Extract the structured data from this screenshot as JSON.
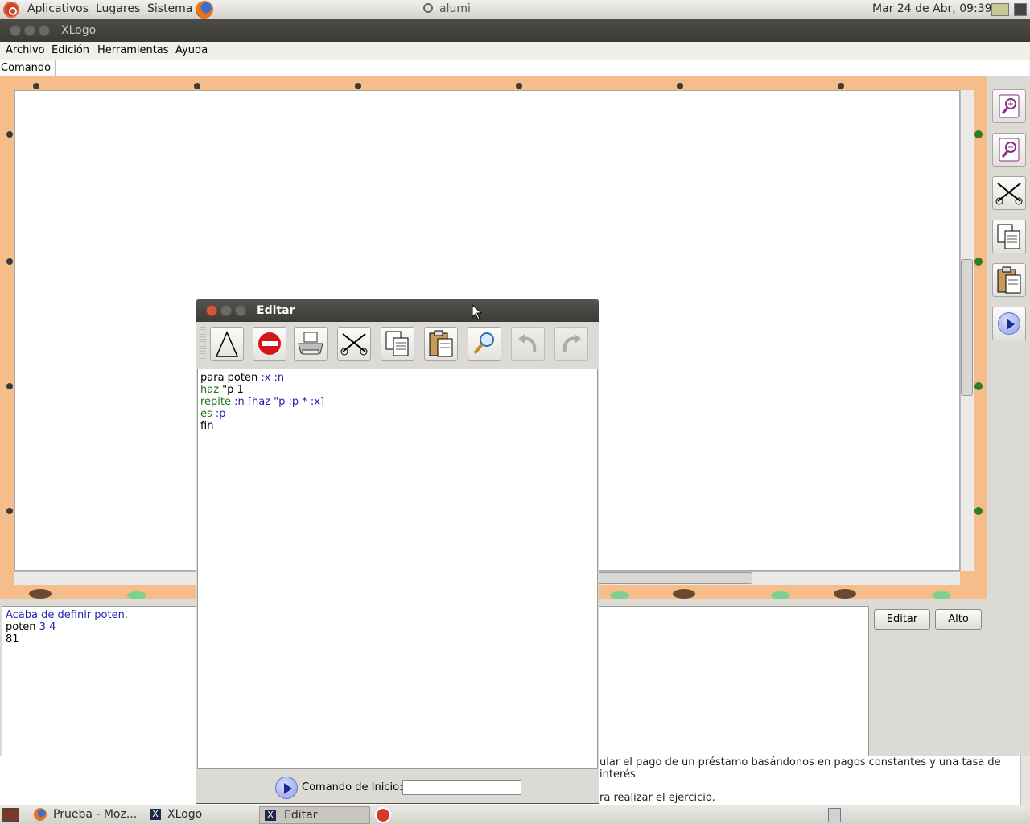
{
  "top_panel": {
    "menus": [
      "Aplicativos",
      "Lugares",
      "Sistema"
    ],
    "window_title": "alumi",
    "clock": "Mar 24 de Abr, 09:39"
  },
  "xlogo": {
    "title": "XLogo",
    "menus": [
      "Archivo",
      "Edición",
      "Herramientas",
      "Ayuda"
    ],
    "command_label": "Comando",
    "history": [
      {
        "text": "Acaba de definir poten.",
        "color": "#2323b8"
      },
      {
        "parts": [
          "poten",
          "3 4"
        ]
      },
      {
        "text": "81"
      }
    ],
    "buttons": {
      "edit": "Editar",
      "stop": "Alto"
    },
    "right_toolbar": [
      "zoom-in-icon",
      "zoom-out-icon",
      "scissors-icon",
      "copy-icon",
      "paste-icon",
      "play-icon"
    ]
  },
  "editor": {
    "title": "Editar",
    "toolbar": [
      "triangle-icon",
      "stop-icon",
      "printer-icon",
      "scissors-icon",
      "copy-icon",
      "paste-icon",
      "search-icon",
      "undo-icon",
      "redo-icon"
    ],
    "code": [
      {
        "a": "para poten ",
        "b": ":x :n",
        "c": ""
      },
      {
        "a": "haz ",
        "b": "\"p 1",
        "c": ""
      },
      {
        "a": "repite ",
        "b": ":n ",
        "c": "[haz \"p :p * :x]"
      },
      {
        "a": "es ",
        "b": ":p",
        "c": ""
      },
      {
        "a": "fin",
        "b": "",
        "c": ""
      }
    ],
    "start_command_label": "Comando de Inicio:",
    "start_command_value": ""
  },
  "background_page": {
    "line1": "ular el pago de un préstamo basándonos en pagos constantes y una tasa de interés",
    "line2": "ra realizar el ejercicio."
  },
  "taskbar": {
    "items": [
      "Prueba - Moz...",
      "XLogo",
      "Editar"
    ]
  }
}
